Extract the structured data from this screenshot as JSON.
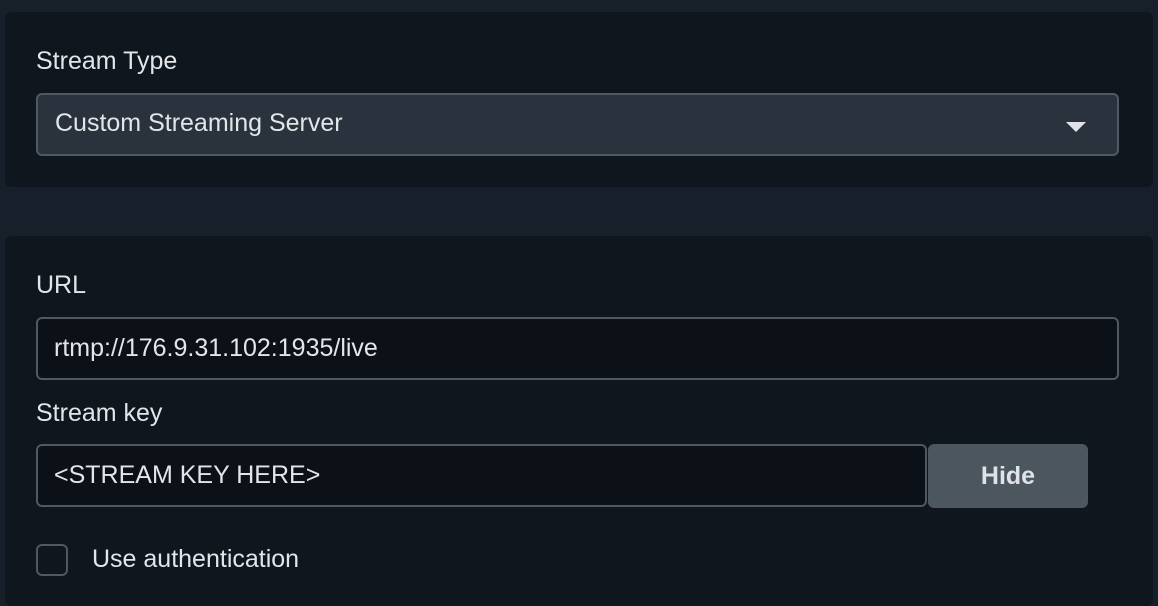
{
  "stream_type": {
    "label": "Stream Type",
    "selected": "Custom Streaming Server",
    "icon": "chevron-down-icon"
  },
  "server": {
    "url_label": "URL",
    "url_value": "rtmp://176.9.31.102:1935/live",
    "key_label": "Stream key",
    "key_value": "<STREAM KEY HERE>",
    "hide_label": "Hide",
    "auth_label": "Use authentication",
    "auth_checked": false
  },
  "colors": {
    "background": "#17202a",
    "panel": "#0f161d",
    "select_bg": "#2a333d",
    "input_bg": "#0b1117",
    "border": "#4e5964",
    "button_bg": "#4c565f",
    "text": "#e3e5e8"
  }
}
